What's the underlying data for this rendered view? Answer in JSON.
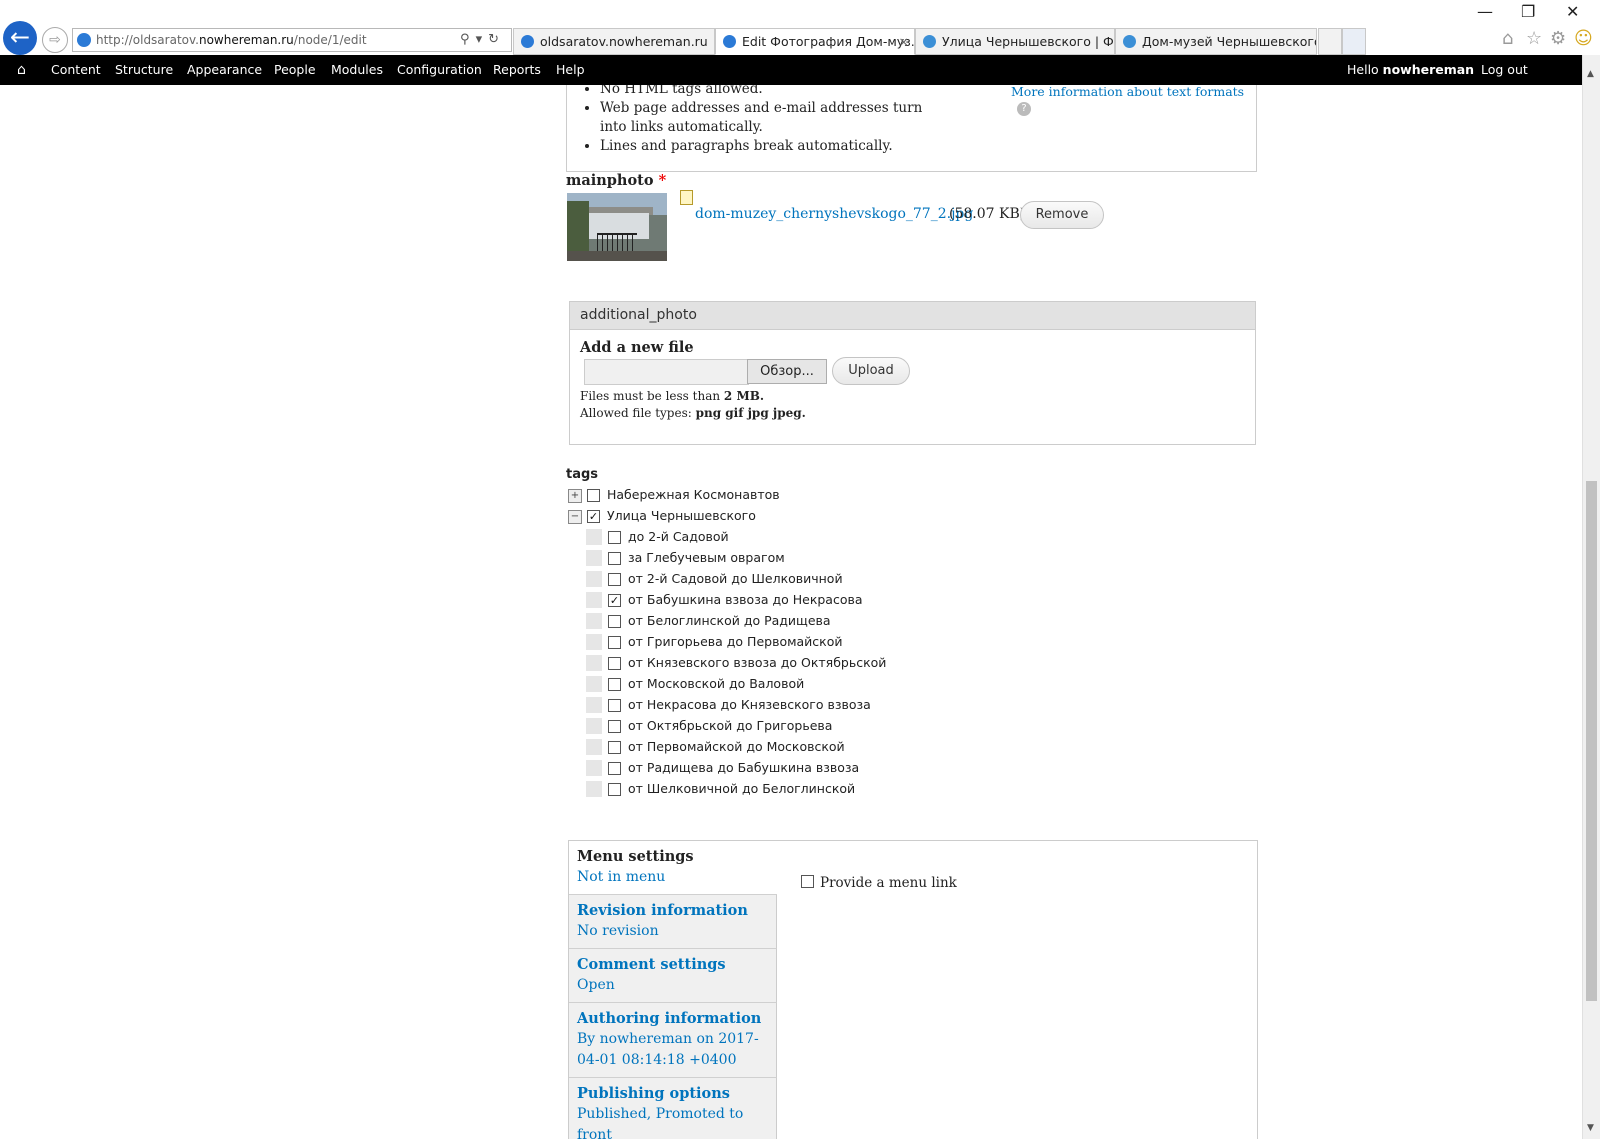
{
  "browser": {
    "url_prefix": "http://oldsaratov.",
    "url_domain": "nowhereman.ru",
    "url_path": "/node/1/edit",
    "tabs": [
      {
        "label": "oldsaratov.nowhereman.ru",
        "active": false
      },
      {
        "label": "Edit Фотография Дом-муз...",
        "active": true
      },
      {
        "label": "Улица Чернышевского | Фот...",
        "active": false
      },
      {
        "label": "Дом-музей Чернышевского |...",
        "active": false
      }
    ],
    "close_glyph": "×"
  },
  "toolbar": {
    "home_icon": "home-icon",
    "items": [
      "Content",
      "Structure",
      "Appearance",
      "People",
      "Modules",
      "Configuration",
      "Reports",
      "Help"
    ],
    "hello_prefix": "Hello",
    "username": "nowhereman",
    "logout": "Log out"
  },
  "text_format_tips": {
    "items": [
      "No HTML tags allowed.",
      "Web page addresses and e-mail addresses turn into links automatically.",
      "Lines and paragraphs break automatically."
    ],
    "more_info": "More information about text formats",
    "help_glyph": "?"
  },
  "mainphoto": {
    "label": "mainphoto",
    "required_mark": "*",
    "file_name": "dom-muzey_chernyshevskogo_77_2.jpg",
    "file_size": "(58.07 KB)",
    "remove_label": "Remove"
  },
  "additional_photo": {
    "legend": "additional_photo",
    "add_label": "Add a new file",
    "browse_label": "Обзор...",
    "upload_label": "Upload",
    "size_prefix": "Files must be less than",
    "size_value": "2 MB.",
    "types_prefix": "Allowed file types:",
    "types_value": "png gif jpg jpeg."
  },
  "tags": {
    "label": "tags",
    "top_level": [
      {
        "label": "Набережная Космонавтов",
        "checked": false,
        "expanded": false
      },
      {
        "label": "Улица Чернышевского",
        "checked": true,
        "expanded": true
      }
    ],
    "children": [
      {
        "label": "до 2-й Садовой",
        "checked": false
      },
      {
        "label": "за Глебучевым оврагом",
        "checked": false
      },
      {
        "label": "от 2-й Садовой до Шелковичной",
        "checked": false
      },
      {
        "label": "от Бабушкина взвоза до Некрасова",
        "checked": true
      },
      {
        "label": "от Белоглинской до Радищева",
        "checked": false
      },
      {
        "label": "от Григорьева до Первомайской",
        "checked": false
      },
      {
        "label": "от Князевского взвоза до Октябрьской",
        "checked": false
      },
      {
        "label": "от Московской до Валовой",
        "checked": false
      },
      {
        "label": "от Некрасова до Князевского взвоза",
        "checked": false
      },
      {
        "label": "от Октябрьской до Григорьева",
        "checked": false
      },
      {
        "label": "от Первомайской до Московской",
        "checked": false
      },
      {
        "label": "от Радищева до Бабушкина взвоза",
        "checked": false
      },
      {
        "label": "от Шелковичной до Белоглинской",
        "checked": false
      }
    ]
  },
  "vertical_tabs": {
    "tabs": [
      {
        "title": "Menu settings",
        "summary": "Not in menu",
        "active": true
      },
      {
        "title": "Revision information",
        "summary": "No revision",
        "active": false
      },
      {
        "title": "Comment settings",
        "summary": "Open",
        "active": false
      },
      {
        "title": "Authoring information",
        "summary": "By nowhereman on 2017-04-01 08:14:18 +0400",
        "active": false
      },
      {
        "title": "Publishing options",
        "summary": "Published, Promoted to front",
        "active": false
      }
    ],
    "menu_link_label": "Provide a menu link",
    "menu_link_checked": false
  },
  "colors": {
    "link": "#0074bd",
    "toolbar_bg": "#000000",
    "required": "#ee0000"
  }
}
